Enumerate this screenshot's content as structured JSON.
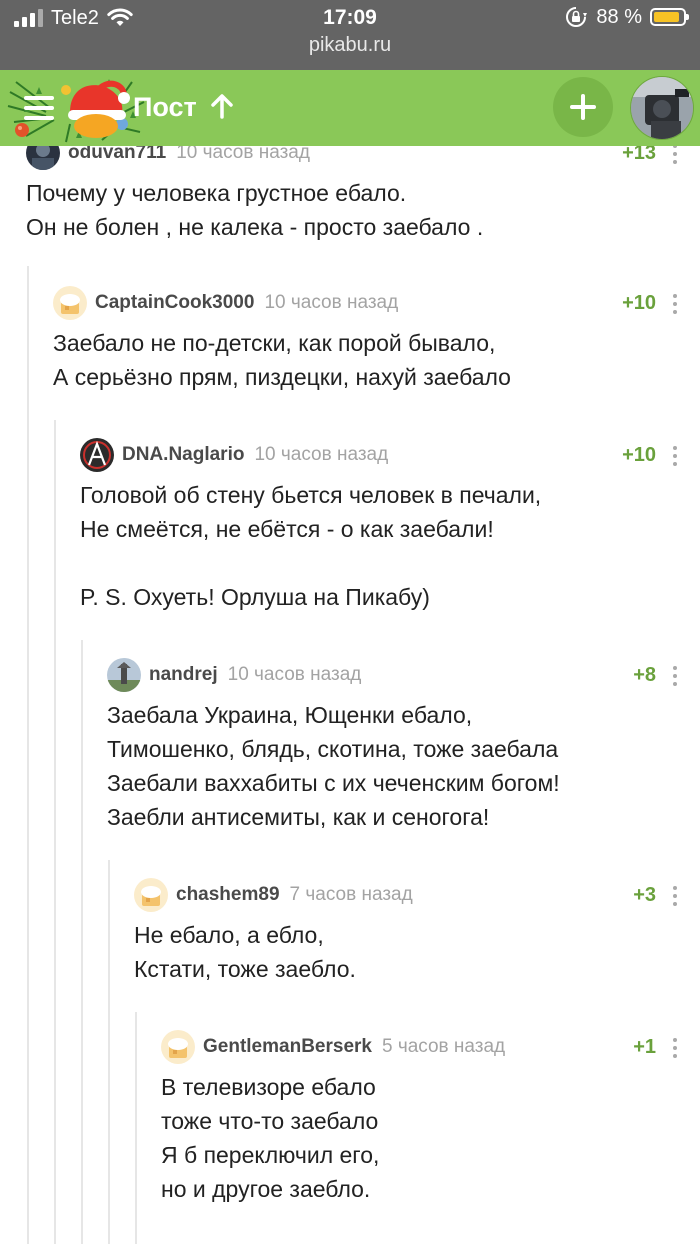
{
  "status_bar": {
    "carrier": "Tele2",
    "time": "17:09",
    "battery_percent": "88 %",
    "battery_level": 0.88,
    "url": "pikabu.ru"
  },
  "header": {
    "title": "Пост",
    "menu_icon": "hamburger-menu-icon",
    "add_icon": "plus-icon",
    "colors": {
      "header_bg": "#8ac858",
      "rating": "#6aa13c"
    }
  },
  "comments": [
    {
      "user": "oduvan711",
      "time": "10 часов назад",
      "rating": "+13",
      "lines": [
        "Почему у человека грустное ебало.",
        "Он не болен , не калека - просто заебало ."
      ]
    },
    {
      "user": "CaptainCook3000",
      "time": "10 часов назад",
      "rating": "+10",
      "lines": [
        "Заебало не по-детски, как порой бывало,",
        "А серьёзно прям, пиздецки, нахуй заебало"
      ]
    },
    {
      "user": "DNA.Naglario",
      "time": "10 часов назад",
      "rating": "+10",
      "lines": [
        "Головой об стену бьется человек в печали,",
        "Не смеётся, не ебётся - о как заебали!",
        "",
        "P. S. Охуеть! Орлуша на Пикабу)"
      ]
    },
    {
      "user": "nandrej",
      "time": "10 часов назад",
      "rating": "+8",
      "lines": [
        "Заебала Украина, Ющенки ебало,",
        "Тимошенко, блядь, скотина, тоже заебала",
        "Заебали ваххабиты с их чеченским богом!",
        "Заебли антисемиты, как и сеногога!"
      ]
    },
    {
      "user": "chashem89",
      "time": "7 часов назад",
      "rating": "+3",
      "lines": [
        "Не ебало, а ебло,",
        "Кстати, тоже заебло."
      ]
    },
    {
      "user": "GentlemanBerserk",
      "time": "5 часов назад",
      "rating": "+1",
      "lines": [
        "В телевизоре ебало",
        "тоже что-то заебало",
        "Я б переключил его,",
        "но и другое заебло."
      ]
    }
  ]
}
